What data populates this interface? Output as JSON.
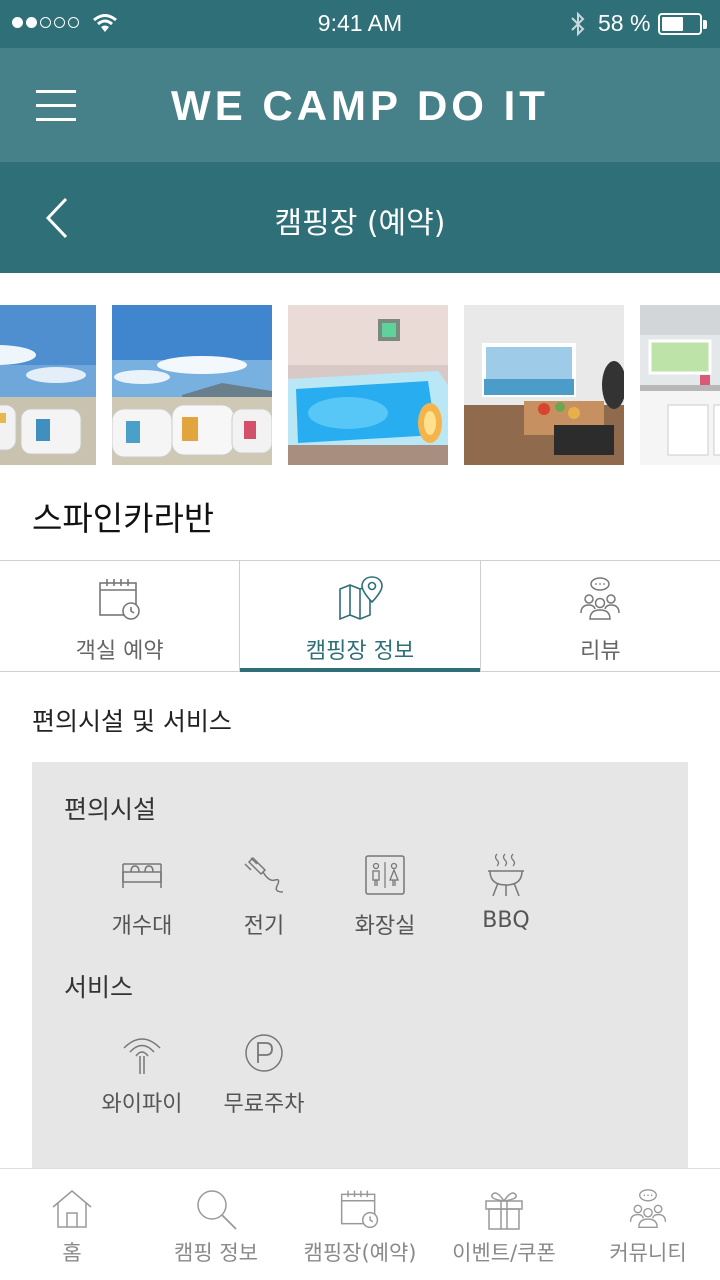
{
  "status_bar": {
    "time": "9:41 AM",
    "battery_percent": "58 %",
    "battery_level": 0.58,
    "signal_bars_filled": 2,
    "signal_bars_total": 5
  },
  "app_bar": {
    "menu_icon": "hamburger-menu-icon",
    "title": "WE CAMP DO IT"
  },
  "sub_bar": {
    "back_icon": "chevron-left-icon",
    "title": "캠핑장 (예약)"
  },
  "gallery": {
    "photos": [
      "caravans-photo",
      "caravans-under-sky-photo",
      "spa-pool-photo",
      "bbq-dining-photo",
      "kitchen-interior-photo"
    ]
  },
  "campsite": {
    "name": "스파인카라반"
  },
  "tabs": [
    {
      "label": "객실 예약",
      "icon": "calendar-clock-icon",
      "active": false
    },
    {
      "label": "캠핑장 정보",
      "icon": "map-pin-icon",
      "active": true
    },
    {
      "label": "리뷰",
      "icon": "people-chat-icon",
      "active": false
    }
  ],
  "amenities": {
    "section_title": "편의시설 및 서비스",
    "facilities_title": "편의시설",
    "facilities": [
      {
        "label": "개수대",
        "icon": "sink-icon"
      },
      {
        "label": "전기",
        "icon": "plug-icon"
      },
      {
        "label": "화장실",
        "icon": "restroom-icon"
      },
      {
        "label": "BBQ",
        "icon": "bbq-grill-icon"
      }
    ],
    "services_title": "서비스",
    "services": [
      {
        "label": "와이파이",
        "icon": "wifi-antenna-icon"
      },
      {
        "label": "무료주차",
        "icon": "parking-icon"
      }
    ]
  },
  "bottom_nav": [
    {
      "label": "홈",
      "icon": "home-icon"
    },
    {
      "label": "캠핑 정보",
      "icon": "search-icon"
    },
    {
      "label": "캠핑장(예약)",
      "icon": "calendar-clock-icon"
    },
    {
      "label": "이벤트/쿠폰",
      "icon": "gift-icon"
    },
    {
      "label": "커뮤니티",
      "icon": "people-chat-icon"
    }
  ],
  "colors": {
    "primary_dark": "#2f6f78",
    "primary": "#468089",
    "panel_bg": "#e6e6e6",
    "icon_gray": "#777777"
  }
}
